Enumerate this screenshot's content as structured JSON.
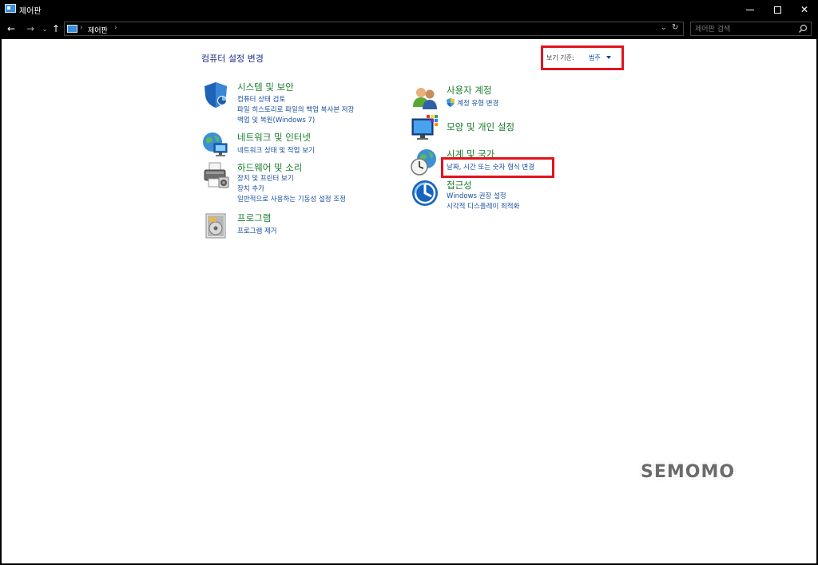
{
  "window": {
    "title": "제어판"
  },
  "nav": {
    "breadcrumb": "제어판",
    "search_placeholder": "제어판 검색"
  },
  "page": {
    "heading": "컴퓨터 설정 변경",
    "view_by_label": "보기 기준:",
    "view_by_value": "범주"
  },
  "categories_left": [
    {
      "title": "시스템 및 보안",
      "icon": "shield-icon",
      "links": [
        "컴퓨터 상태 검토",
        "파일 히스토리로 파일의 백업 복사본 저장",
        "백업 및 복원(Windows 7)"
      ]
    },
    {
      "title": "네트워크 및 인터넷",
      "icon": "network-globe-icon",
      "links": [
        "네트워크 상태 및 작업 보기"
      ]
    },
    {
      "title": "하드웨어 및 소리",
      "icon": "printer-icon",
      "links": [
        "장치 및 프린터 보기",
        "장치 추가",
        "일반적으로 사용하는 기동성 설정 조정"
      ]
    },
    {
      "title": "프로그램",
      "icon": "program-disc-icon",
      "links": [
        "프로그램 제거"
      ]
    }
  ],
  "categories_right": [
    {
      "title": "사용자 계정",
      "icon": "users-icon",
      "links": [
        "계정 유형 변경"
      ]
    },
    {
      "title": "모양 및 개인 설정",
      "icon": "monitor-palette-icon",
      "links": []
    },
    {
      "title": "시계 및 국가",
      "icon": "clock-globe-icon",
      "links": [
        "날짜, 시간 또는 숫자 형식 변경"
      ]
    },
    {
      "title": "접근성",
      "icon": "accessibility-icon",
      "links": [
        "Windows 권장 설정",
        "시각적 디스플레이 최적화"
      ]
    }
  ],
  "watermark": "SEMOMO",
  "colors": {
    "category_title": "#1b7d2e",
    "link": "#1c4fa0",
    "heading": "#1e3287",
    "highlight": "#e0141e"
  }
}
